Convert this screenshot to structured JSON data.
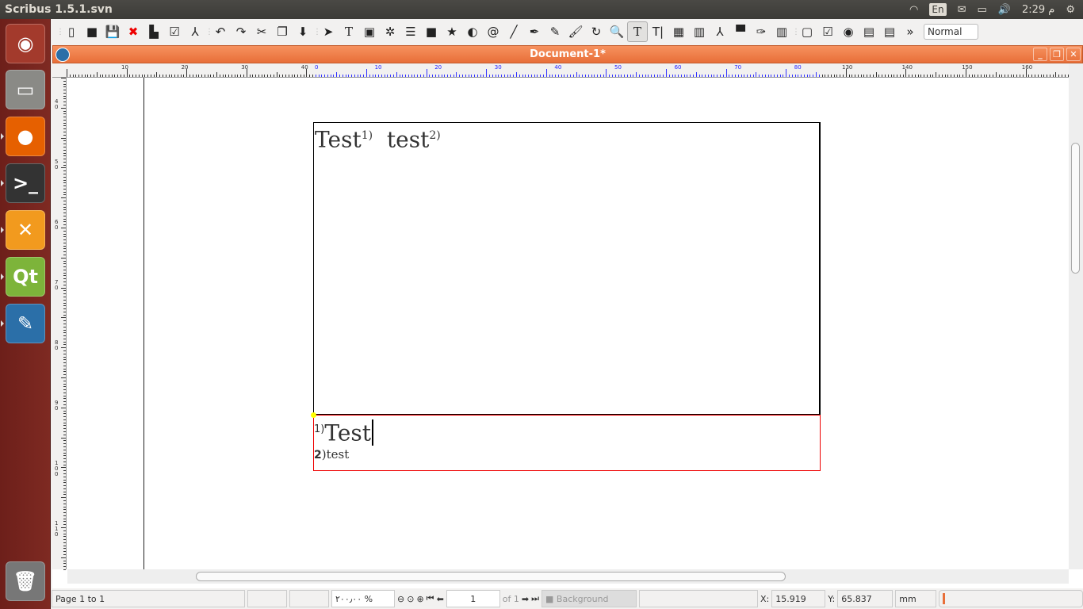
{
  "topbar": {
    "app_title": "Scribus 1.5.1.svn",
    "keyboard": "En",
    "clock": "2:29 م",
    "icons": [
      "wifi-icon",
      "keyboard-icon",
      "mail-icon",
      "battery-icon",
      "volume-icon",
      "power-icon"
    ]
  },
  "launcher": [
    {
      "name": "ubuntu-dash",
      "glyph": "◉",
      "bg": "#a33a2c"
    },
    {
      "name": "files",
      "glyph": "▭",
      "bg": "#8a8a86"
    },
    {
      "name": "firefox",
      "glyph": "●",
      "bg": "#e66000"
    },
    {
      "name": "terminal",
      "glyph": ">_",
      "bg": "#333"
    },
    {
      "name": "xchat",
      "glyph": "✕",
      "bg": "#f29a1e"
    },
    {
      "name": "qt-creator",
      "glyph": "Qt",
      "bg": "#7db43a"
    },
    {
      "name": "scribus",
      "glyph": "✎",
      "bg": "#2b6fa8"
    },
    {
      "name": "trash",
      "glyph": "🗑",
      "bg": "#777"
    }
  ],
  "toolbar": {
    "groups": [
      [
        [
          "new-icon",
          "▯"
        ],
        [
          "open-icon",
          "■"
        ],
        [
          "save-icon",
          "💾"
        ],
        [
          "close-icon",
          "✖"
        ],
        [
          "print-icon",
          "▙"
        ],
        [
          "preflight-icon",
          "☑"
        ],
        [
          "pdf-icon",
          "⅄"
        ]
      ],
      [
        [
          "undo-icon",
          "↶"
        ],
        [
          "redo-icon",
          "↷"
        ],
        [
          "cut-icon",
          "✂"
        ],
        [
          "copy-icon",
          "❐"
        ],
        [
          "paste-icon",
          "⬇"
        ]
      ],
      [
        [
          "select-icon",
          "➤"
        ],
        [
          "text-frame-icon",
          "T"
        ],
        [
          "image-frame-icon",
          "▣"
        ],
        [
          "render-frame-icon",
          "✲"
        ],
        [
          "table-icon",
          "☰"
        ],
        [
          "shape-icon",
          "■"
        ],
        [
          "polygon-icon",
          "★"
        ],
        [
          "arc-icon",
          "◐"
        ],
        [
          "spiral-icon",
          "@"
        ],
        [
          "line-icon",
          "╱"
        ],
        [
          "bezier-icon",
          "✒"
        ],
        [
          "freehand-icon",
          "✎"
        ],
        [
          "calligraphic-icon",
          "🖌"
        ],
        [
          "rotate-icon",
          "↻"
        ],
        [
          "zoom-icon",
          "🔍"
        ],
        [
          "edit-contents-icon",
          "T"
        ],
        [
          "edit-text-icon",
          "T|"
        ],
        [
          "link-frames-icon",
          "▦"
        ],
        [
          "unlink-frames-icon",
          "▥"
        ],
        [
          "measure-icon",
          "⅄"
        ],
        [
          "copy-properties-icon",
          "▀"
        ],
        [
          "eyedropper-icon",
          "✑"
        ],
        [
          "barcode-icon",
          "▥"
        ]
      ],
      [
        [
          "pdf-button-icon",
          "▢"
        ],
        [
          "pdf-checkbox-icon",
          "☑"
        ],
        [
          "pdf-radio-icon",
          "◉"
        ],
        [
          "pdf-textfield-icon",
          "▤"
        ],
        [
          "pdf-listbox-icon",
          "▤"
        ]
      ]
    ],
    "active": "edit-contents-icon",
    "more": "»",
    "mode": "Normal"
  },
  "document": {
    "title": "Document-1*",
    "body_text": "Test",
    "body_ref1": "1)",
    "body_word2": "test",
    "body_ref2": "2)",
    "fn1_mark": "1)",
    "fn1_text": "Test",
    "fn2_mark": "2",
    "fn2_text": ")test"
  },
  "rulers": {
    "h_black": [
      "10",
      "20",
      "30",
      "40"
    ],
    "h_blue": [
      "0",
      "10",
      "20",
      "30",
      "40",
      "50",
      "60",
      "70",
      "80"
    ],
    "h_black2": [
      "130",
      "140",
      "150",
      "160"
    ],
    "v": [
      "40",
      "50",
      "60",
      "70",
      "80",
      "90",
      "100",
      "110"
    ]
  },
  "status": {
    "page_info": "Page 1 to 1",
    "zoom": "٢٠٠٫٠٠ %",
    "page": "1",
    "of": "of 1",
    "layer": "Background",
    "x_label": "X:",
    "x": "15.919",
    "y_label": "Y:",
    "y": "65.837",
    "unit": "mm"
  }
}
